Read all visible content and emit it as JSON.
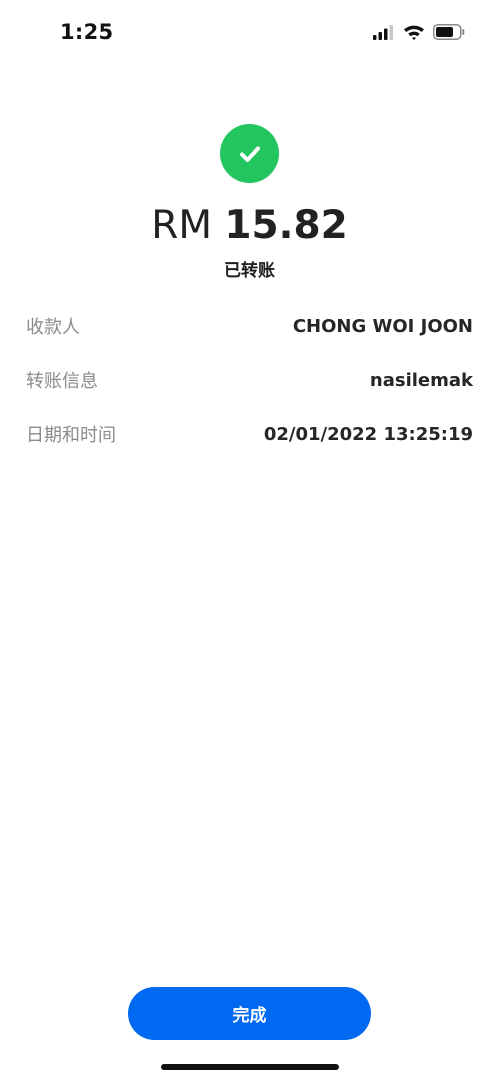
{
  "status_bar": {
    "time": "1:25",
    "icons": [
      "cellular-signal-icon",
      "wifi-icon",
      "battery-icon"
    ]
  },
  "receipt": {
    "success_icon": "check-circle-icon",
    "success_color": "#22c55e",
    "currency": "RM",
    "amount": "15.82",
    "status": "已转账"
  },
  "details": [
    {
      "label": "收款人",
      "value": "CHONG WOI JOON"
    },
    {
      "label": "转账信息",
      "value": "nasilemak"
    },
    {
      "label": "日期和时间",
      "value": "02/01/2022 13:25:19"
    }
  ],
  "footer": {
    "done_label": "完成",
    "accent_color": "#0069f2"
  }
}
